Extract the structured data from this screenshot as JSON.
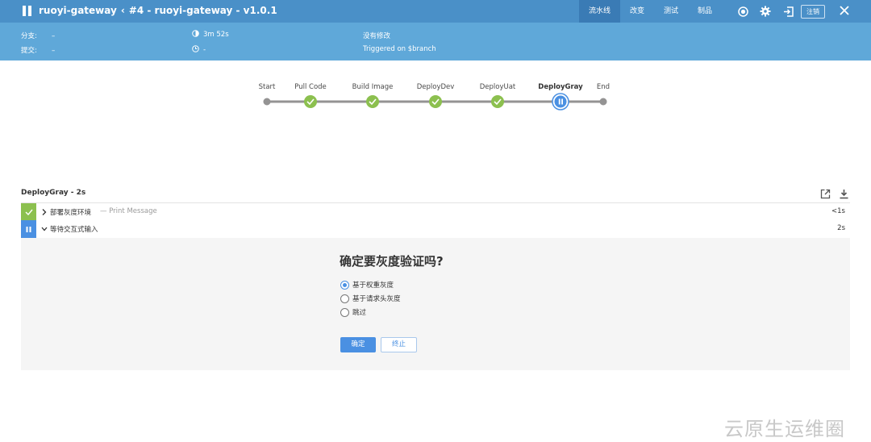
{
  "header": {
    "job_name": "ruoyi-gateway",
    "run_title": "#4 - ruoyi-gateway - v1.0.1",
    "tabs": [
      {
        "label": "流水线",
        "active": true
      },
      {
        "label": "改变",
        "active": false
      },
      {
        "label": "测试",
        "active": false
      },
      {
        "label": "制品",
        "active": false
      }
    ],
    "logout_label": "注销"
  },
  "info": {
    "branch_label": "分支:",
    "branch_value": "–",
    "commit_label": "提交:",
    "commit_value": "–",
    "duration": "3m 52s",
    "time_value": "-",
    "changes": "没有修改",
    "trigger": "Triggered on $branch"
  },
  "pipeline": {
    "stages": [
      {
        "name": "Start",
        "status": "start"
      },
      {
        "name": "Pull Code",
        "status": "success"
      },
      {
        "name": "Build Image",
        "status": "success"
      },
      {
        "name": "DeployDev",
        "status": "success"
      },
      {
        "name": "DeployUat",
        "status": "success"
      },
      {
        "name": "DeployGray",
        "status": "paused"
      },
      {
        "name": "End",
        "status": "end"
      }
    ],
    "colors": {
      "success": "#8cc04f",
      "paused": "#4a90e2",
      "line": "#949393"
    }
  },
  "stage_detail": {
    "title": "DeployGray - 2s",
    "steps": [
      {
        "name": "部署灰度环境",
        "desc": "— Print Message",
        "duration": "<1s",
        "status": "success"
      },
      {
        "name": "等待交互式输入",
        "desc": "",
        "duration": "2s",
        "status": "paused"
      }
    ]
  },
  "input_prompt": {
    "question": "确定要灰度验证吗?",
    "options": [
      {
        "label": "基于权重灰度",
        "checked": true
      },
      {
        "label": "基于请求头灰度",
        "checked": false
      },
      {
        "label": "跳过",
        "checked": false
      }
    ],
    "ok_label": "确定",
    "abort_label": "终止"
  },
  "watermark": "云原生运维圈"
}
